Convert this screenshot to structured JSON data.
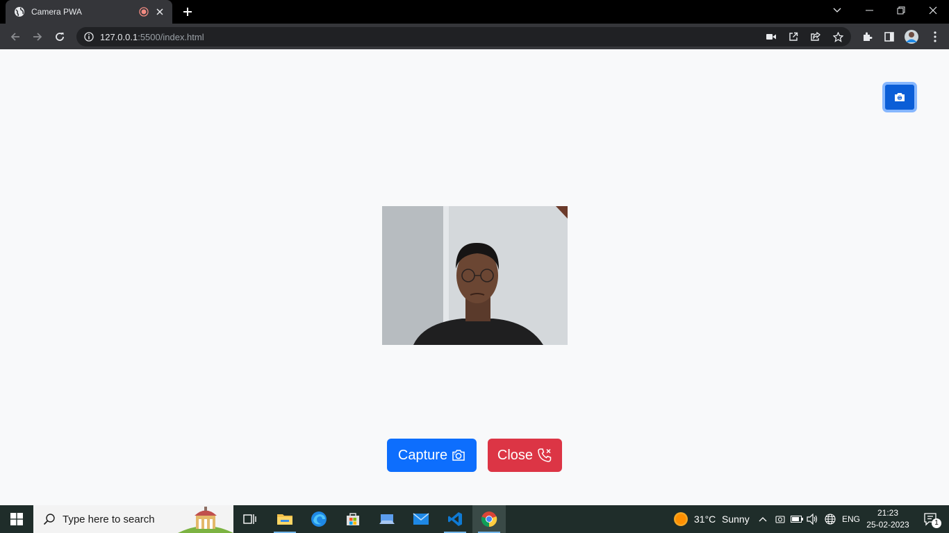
{
  "browser": {
    "tab_title": "Camera PWA",
    "url_host": "127.0.0.1",
    "url_rest": ":5500/index.html"
  },
  "page": {
    "capture_label": "Capture",
    "close_label": "Close",
    "colors": {
      "primary": "#0d6efd",
      "danger": "#dc3545",
      "background": "#f8f9fa"
    }
  },
  "taskbar": {
    "search_placeholder": "Type here to search",
    "temperature": "31°C",
    "weather": "Sunny",
    "language": "ENG",
    "time": "21:23",
    "date": "25-02-2023",
    "notification_count": "1"
  }
}
